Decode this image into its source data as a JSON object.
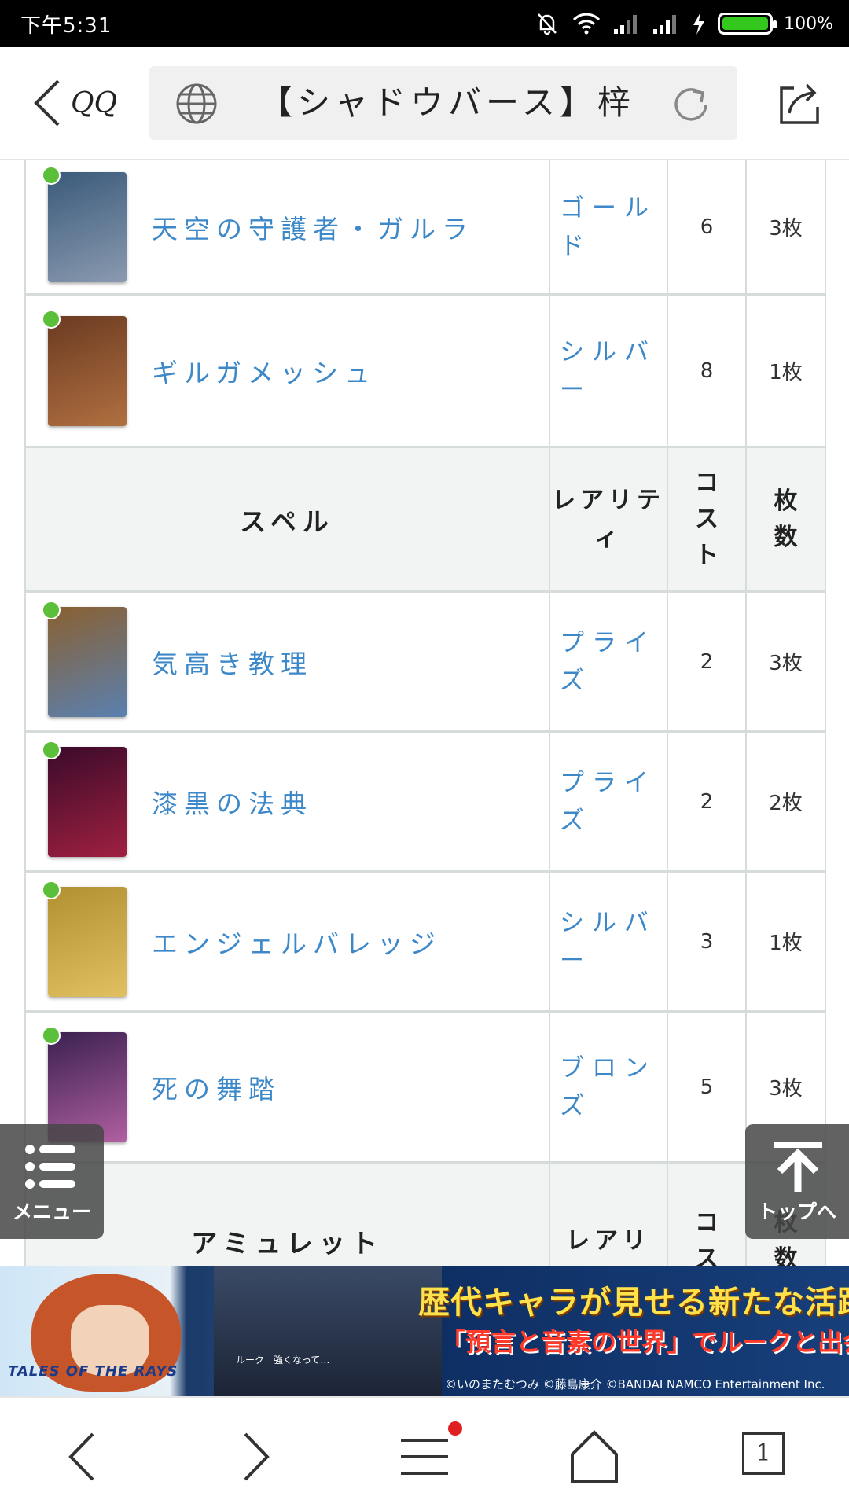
{
  "status_bar": {
    "time": "下午5:31",
    "battery_percent": "100%",
    "battery_level": 1.0
  },
  "browser": {
    "back_label": "QQ",
    "page_title": "【シャドウバース】梓",
    "tab_count": "1"
  },
  "table": {
    "rows": [
      {
        "kind": "card",
        "name": "天空の守護者・ガルラ",
        "rarity": "ゴールド",
        "cost": "6",
        "count": "3枚",
        "colors": [
          "#3a5a7a",
          "#8a9ab0"
        ]
      },
      {
        "kind": "card",
        "name": "ギルガメッシュ",
        "rarity": "シルバー",
        "cost": "8",
        "count": "1枚",
        "colors": [
          "#6b3a22",
          "#b07040"
        ]
      },
      {
        "kind": "header",
        "name": "スペル",
        "rarity": "レアリティ",
        "cost": "コスト",
        "count": "枚数"
      },
      {
        "kind": "card",
        "name": "気高き教理",
        "rarity": "プライズ",
        "cost": "2",
        "count": "3枚",
        "colors": [
          "#8a6030",
          "#5a80b0"
        ]
      },
      {
        "kind": "card",
        "name": "漆黒の法典",
        "rarity": "プライズ",
        "cost": "2",
        "count": "2枚",
        "colors": [
          "#3a0a2a",
          "#a02040"
        ]
      },
      {
        "kind": "card",
        "name": "エンジェルバレッジ",
        "rarity": "シルバー",
        "cost": "3",
        "count": "1枚",
        "colors": [
          "#b09030",
          "#e0c060"
        ]
      },
      {
        "kind": "card",
        "name": "死の舞踏",
        "rarity": "ブロンズ",
        "cost": "5",
        "count": "3枚",
        "colors": [
          "#3a2050",
          "#b060a0"
        ]
      },
      {
        "kind": "header",
        "name": "アミュレット",
        "rarity": "レアリ",
        "cost": "コス",
        "count": "枚数"
      }
    ]
  },
  "floating": {
    "menu_label": "メニュー",
    "top_label": "トップへ"
  },
  "ad": {
    "logo": "TALES OF THE RAYS",
    "headline": "歴代キャラが見せる新たな活躍",
    "subline": "「預言と音素の世界」でルークと出会う!",
    "scene_caption": "ルーク　強くなって…",
    "copyright": "©いのまたむつみ ©藤島康介 ©BANDAI NAMCO Entertainment Inc."
  },
  "bottom_nav": {
    "tab_count": "1"
  }
}
